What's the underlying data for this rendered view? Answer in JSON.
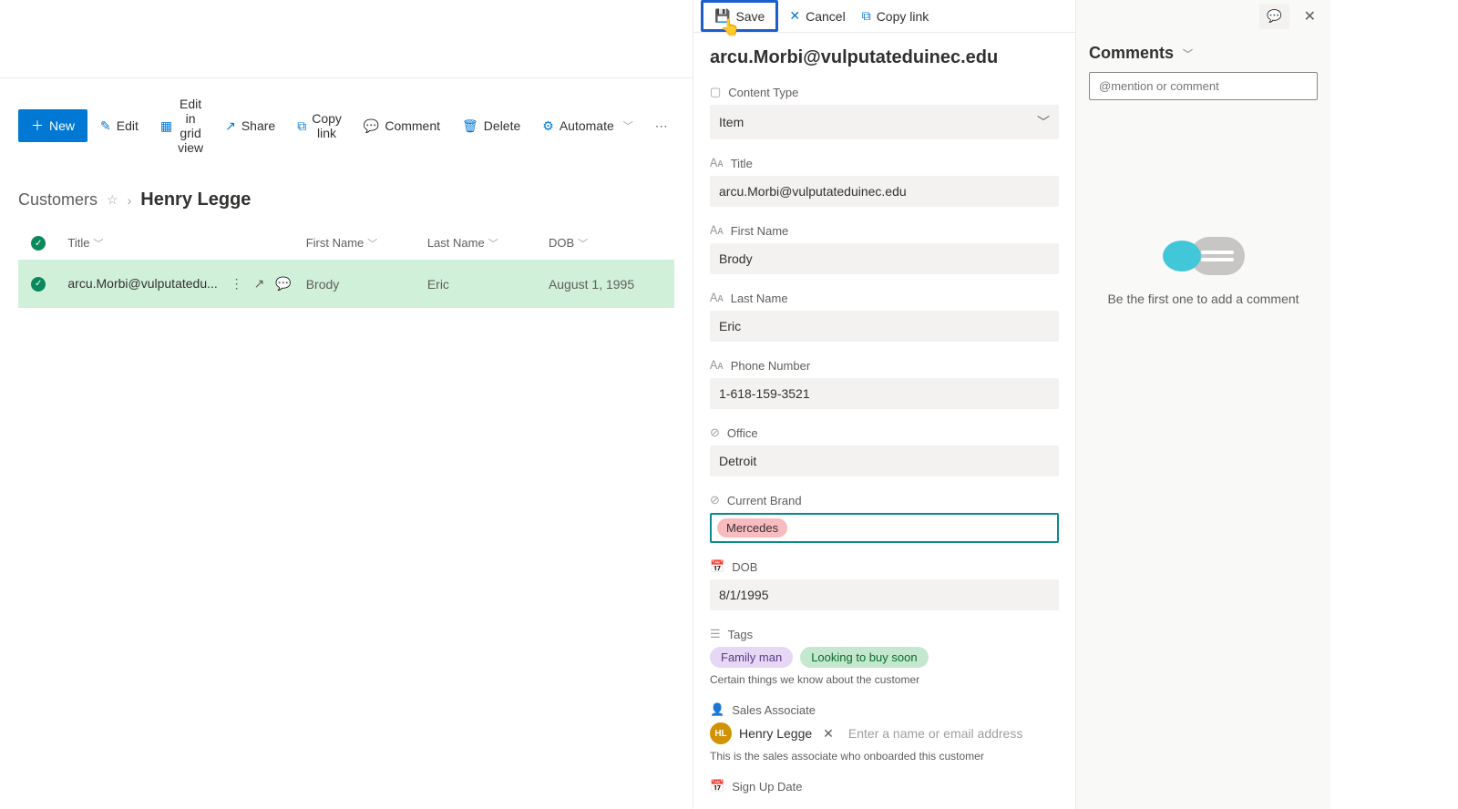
{
  "toolbar": {
    "new": "New",
    "edit": "Edit",
    "edit_grid": "Edit in grid view",
    "share": "Share",
    "copy_link": "Copy link",
    "comment": "Comment",
    "delete": "Delete",
    "automate": "Automate"
  },
  "breadcrumb": {
    "list": "Customers",
    "current": "Henry Legge"
  },
  "grid": {
    "headers": {
      "title": "Title",
      "fname": "First Name",
      "lname": "Last Name",
      "dob": "DOB"
    },
    "rows": [
      {
        "title": "arcu.Morbi@vulputatedu...",
        "fname": "Brody",
        "lname": "Eric",
        "dob": "August 1, 1995"
      }
    ]
  },
  "panel": {
    "save": "Save",
    "cancel": "Cancel",
    "copy_link": "Copy link",
    "title": "arcu.Morbi@vulputateduinec.edu",
    "fields": {
      "content_type": {
        "label": "Content Type",
        "value": "Item"
      },
      "title": {
        "label": "Title",
        "value": "arcu.Morbi@vulputateduinec.edu"
      },
      "first_name": {
        "label": "First Name",
        "value": "Brody"
      },
      "last_name": {
        "label": "Last Name",
        "value": "Eric"
      },
      "phone": {
        "label": "Phone Number",
        "value": "1-618-159-3521"
      },
      "office": {
        "label": "Office",
        "value": "Detroit"
      },
      "brand": {
        "label": "Current Brand",
        "value": "Mercedes"
      },
      "dob": {
        "label": "DOB",
        "value": "8/1/1995"
      },
      "tags": {
        "label": "Tags",
        "values": [
          "Family man",
          "Looking to buy soon"
        ],
        "desc": "Certain things we know about the customer"
      },
      "sales_assoc": {
        "label": "Sales Associate",
        "initials": "HL",
        "name": "Henry Legge",
        "placeholder": "Enter a name or email address",
        "desc": "This is the sales associate who onboarded this customer"
      },
      "signup": {
        "label": "Sign Up Date"
      }
    }
  },
  "comments": {
    "heading": "Comments",
    "placeholder": "@mention or comment",
    "empty": "Be the first one to add a comment"
  }
}
